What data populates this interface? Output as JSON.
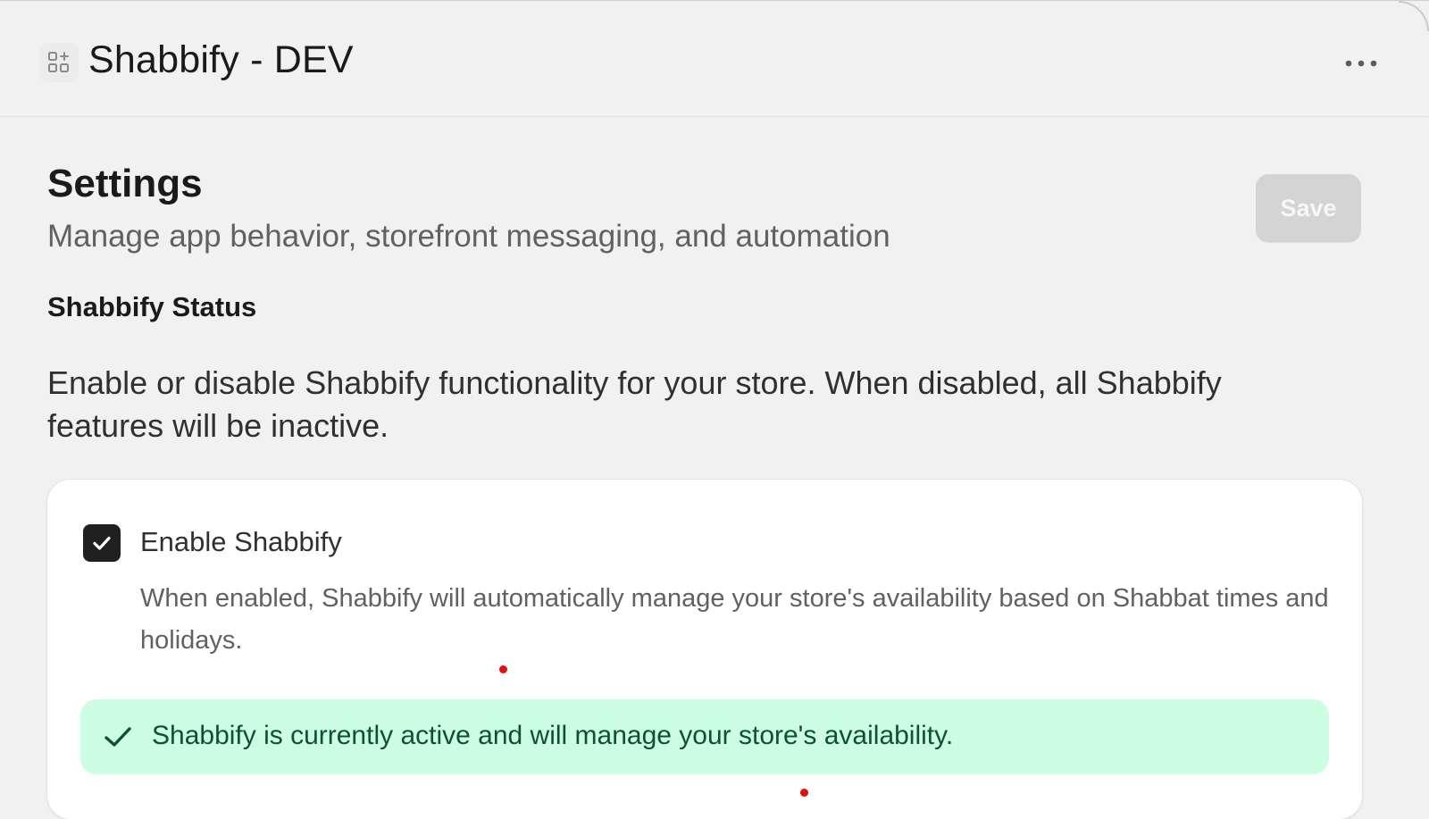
{
  "app": {
    "title": "Shabbify - DEV",
    "icon": "app-grid-icon",
    "more_icon": "more-horizontal-icon"
  },
  "page": {
    "title": "Settings",
    "subtitle": "Manage app behavior, storefront messaging, and automation",
    "save_label": "Save"
  },
  "status_section": {
    "title": "Shabbify Status",
    "description": "Enable or disable Shabbify functionality for your store. When disabled, all Shabbify features will be inactive.",
    "checkbox": {
      "label": "Enable Shabbify",
      "checked": true,
      "help_text": "When enabled, Shabbify will automatically manage your store's availability based on Shabbat times and holidays."
    },
    "banner": {
      "icon": "checkmark-icon",
      "text": "Shabbify is currently active and will manage your store's availability.",
      "color": "#cdfee1"
    }
  },
  "colors": {
    "background": "#f1f1f1",
    "success_banner": "#cdfee1",
    "success_text": "#0c5132",
    "checkbox_fill": "#202020",
    "save_disabled": "#d4d4d4"
  }
}
